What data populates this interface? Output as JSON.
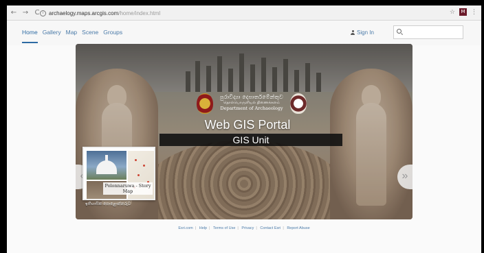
{
  "browser": {
    "back": "←",
    "forward": "→",
    "reload": "C",
    "info": "i",
    "url_host": "archaelogy.maps.arcgis.com",
    "url_path": "/home/index.html",
    "star": "☆",
    "extension": "M",
    "menu": "⋮"
  },
  "header": {
    "nav": [
      "Home",
      "Gallery",
      "Map",
      "Scene",
      "Groups"
    ],
    "signin": "Sign In",
    "search_placeholder": ""
  },
  "banner": {
    "dept_sinhala": "පුරාවිද්‍යා දෙපාර්තමේන්තුව",
    "dept_tamil": "தொல்பொருளியல் திணைக்களம்",
    "dept_english": "Department of Archaeology",
    "title": "Web GIS Portal",
    "subtitle": "GIS Unit",
    "prev_arrow": "«",
    "next_arrow": "»",
    "card_caption": "Polonnaruwa - Story Map",
    "card_label": "ඉතිහාසික පොළොන්නරුව"
  },
  "footer": {
    "links": [
      "Esri.com",
      "Help",
      "Terms of Use",
      "Privacy",
      "Contact Esri",
      "Report Abuse"
    ],
    "separator": "|"
  }
}
